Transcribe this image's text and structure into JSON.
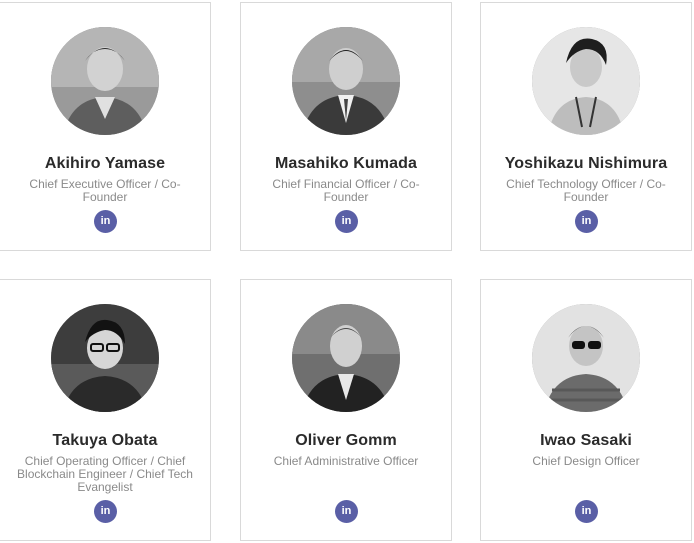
{
  "team": [
    {
      "name": "Akihiro Yamase",
      "role": "Chief Executive Officer / Co-Founder",
      "social_icon": "linkedin-icon",
      "social_label": "in"
    },
    {
      "name": "Masahiko Kumada",
      "role": "Chief Financial Officer / Co-Founder",
      "social_icon": "linkedin-icon",
      "social_label": "in"
    },
    {
      "name": "Yoshikazu Nishimura",
      "role": "Chief Technology Officer / Co-Founder",
      "social_icon": "linkedin-icon",
      "social_label": "in"
    },
    {
      "name": "Takuya Obata",
      "role": "Chief Operating Officer / Chief Blockchain Engineer / Chief Tech Evangelist",
      "social_icon": "linkedin-icon",
      "social_label": "in"
    },
    {
      "name": "Oliver Gomm",
      "role": "Chief Administrative Officer",
      "social_icon": "linkedin-icon",
      "social_label": "in"
    },
    {
      "name": "Iwao Sasaki",
      "role": "Chief Design Officer",
      "social_icon": "linkedin-icon",
      "social_label": "in"
    }
  ],
  "colors": {
    "linkedin_badge": "#5a5fa6",
    "name_text": "#2b2b2b",
    "role_text": "#8a8a8a",
    "card_border": "#d9d9d9"
  }
}
